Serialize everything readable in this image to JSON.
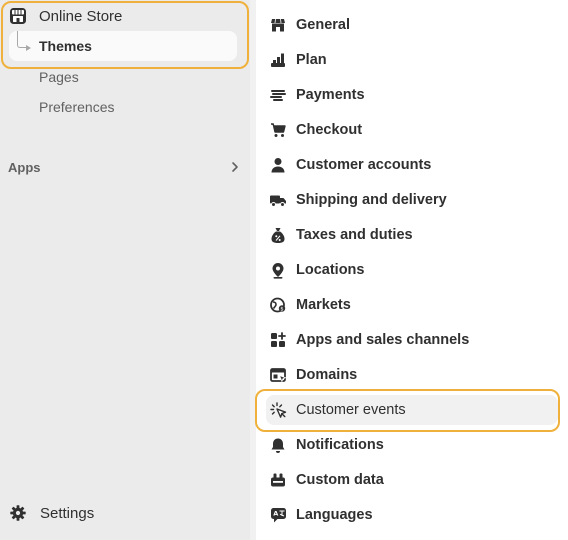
{
  "sidebar": {
    "online_store": {
      "label": "Online Store",
      "icon": "store-icon"
    },
    "themes": {
      "label": "Themes"
    },
    "sub_items": [
      {
        "label": "Pages"
      },
      {
        "label": "Preferences"
      }
    ],
    "apps": {
      "label": "Apps",
      "icon": "chevron-right-icon"
    },
    "settings": {
      "label": "Settings",
      "icon": "gear-icon"
    }
  },
  "settings_nav": {
    "items": [
      {
        "label": "General",
        "icon": "store-icon"
      },
      {
        "label": "Plan",
        "icon": "plan-icon"
      },
      {
        "label": "Payments",
        "icon": "payments-icon"
      },
      {
        "label": "Checkout",
        "icon": "cart-icon"
      },
      {
        "label": "Customer accounts",
        "icon": "person-icon"
      },
      {
        "label": "Shipping and delivery",
        "icon": "truck-icon"
      },
      {
        "label": "Taxes and duties",
        "icon": "tax-icon"
      },
      {
        "label": "Locations",
        "icon": "location-icon"
      },
      {
        "label": "Markets",
        "icon": "globe-icon"
      },
      {
        "label": "Apps and sales channels",
        "icon": "apps-icon"
      },
      {
        "label": "Domains",
        "icon": "domains-icon"
      },
      {
        "label": "Customer events",
        "icon": "cursor-click-icon",
        "active": true
      },
      {
        "label": "Notifications",
        "icon": "bell-icon"
      },
      {
        "label": "Custom data",
        "icon": "custom-data-icon"
      },
      {
        "label": "Languages",
        "icon": "language-icon"
      }
    ]
  },
  "colors": {
    "highlight": "#f0b13c",
    "sidebar_bg": "#ebebeb",
    "text": "#303030",
    "muted_text": "#616161"
  }
}
